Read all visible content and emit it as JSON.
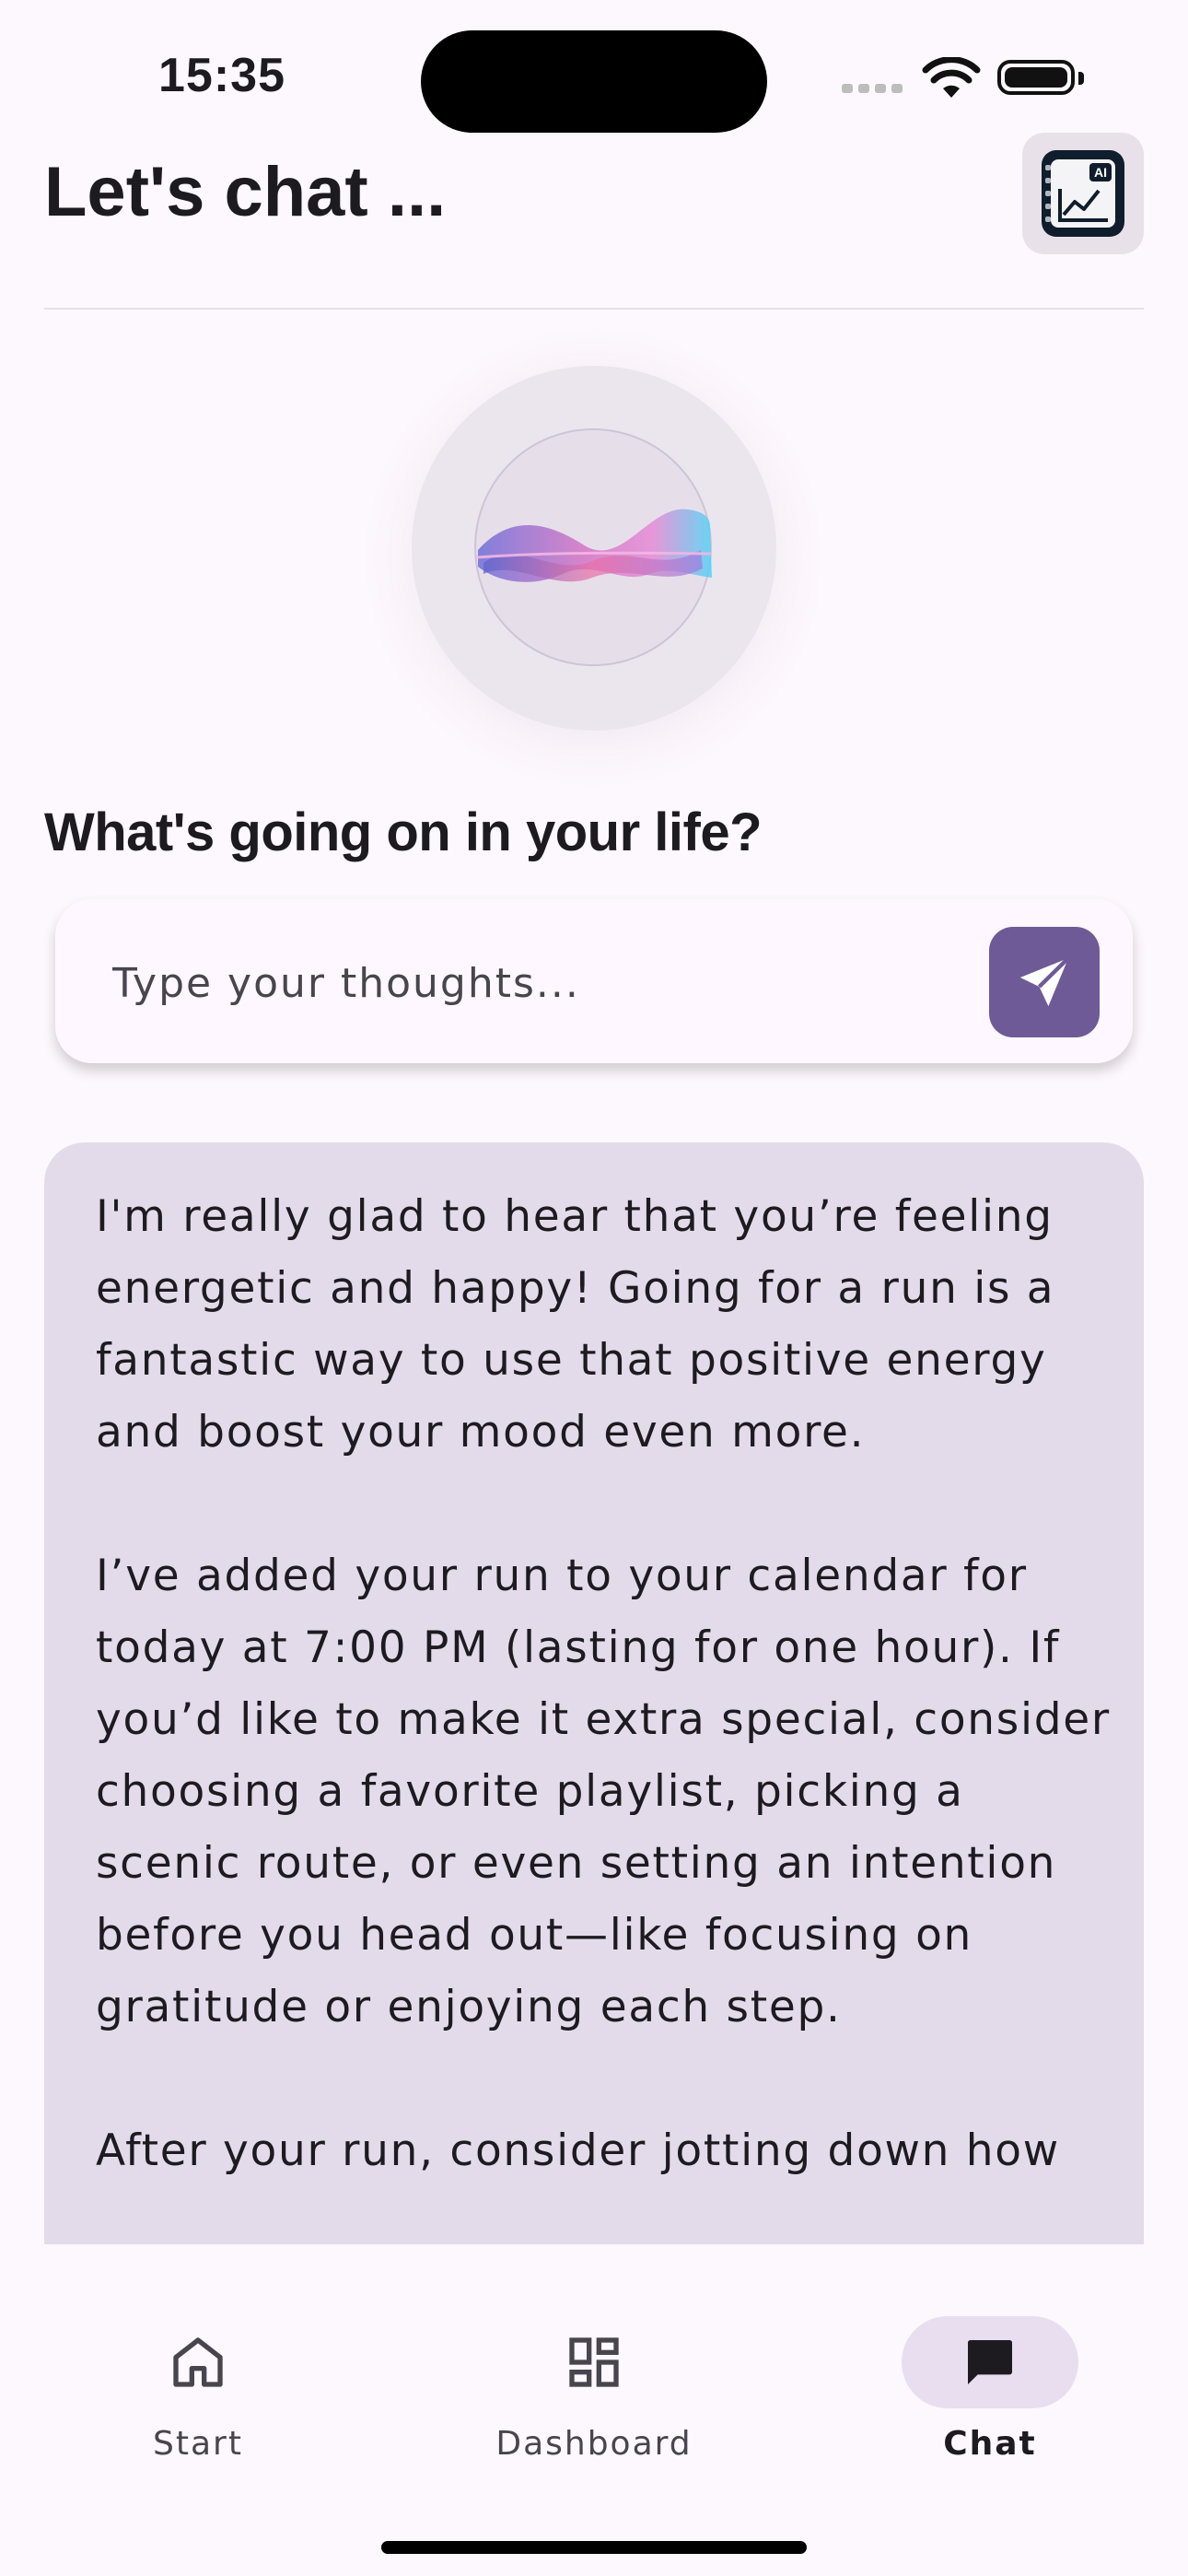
{
  "status_bar": {
    "time": "15:35"
  },
  "header": {
    "title": "Let's chat ...",
    "action_icon": "ai-chart-icon"
  },
  "prompt": {
    "question": "What's going on in your life?"
  },
  "input": {
    "placeholder": "Type your thoughts...",
    "value": "",
    "send_icon": "send-icon"
  },
  "message": {
    "text": "I'm really glad to hear that you’re feeling energetic and happy! Going for a run is a fantastic way to use that positive energy and boost your mood even more.\n\nI’ve added your run to your calendar for today at 7:00 PM (lasting for one hour). If you’d like to make it extra special, consider choosing a favorite playlist, picking a scenic route, or even setting an intention before you head out—like focusing on gratitude or enjoying each step.\n\nAfter your run, consider jotting down how"
  },
  "nav": {
    "items": [
      {
        "label": "Start",
        "icon": "home-icon",
        "active": false
      },
      {
        "label": "Dashboard",
        "icon": "dashboard-icon",
        "active": false
      },
      {
        "label": "Chat",
        "icon": "chat-icon",
        "active": true
      }
    ]
  },
  "colors": {
    "accent": "#6e5a96",
    "message_bg": "#e4dbea",
    "background": "#fdf8fd",
    "active_indicator": "#e8def0"
  }
}
